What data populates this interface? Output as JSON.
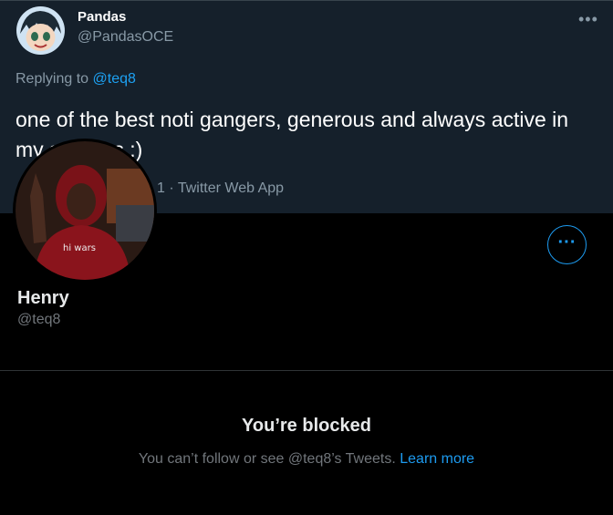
{
  "tweet": {
    "display_name": "Pandas",
    "handle": "@PandasOCE",
    "reply_prefix": "Replying to",
    "reply_mention": "@teq8",
    "text": "one of the best noti gangers, generous and always active in my streams :)",
    "meta_visible": "1 · Twitter Web App",
    "more_icon": "more-horizontal-icon"
  },
  "profile": {
    "name": "Henry",
    "handle": "@teq8",
    "more_button_label": "···"
  },
  "blocked": {
    "title": "You’re blocked",
    "message": "You can’t follow or see @teq8’s Tweets.",
    "link_label": "Learn more"
  },
  "colors": {
    "tweet_bg": "#15202b",
    "page_bg": "#000000",
    "accent": "#1d9bf0",
    "muted": "#8899a6"
  }
}
